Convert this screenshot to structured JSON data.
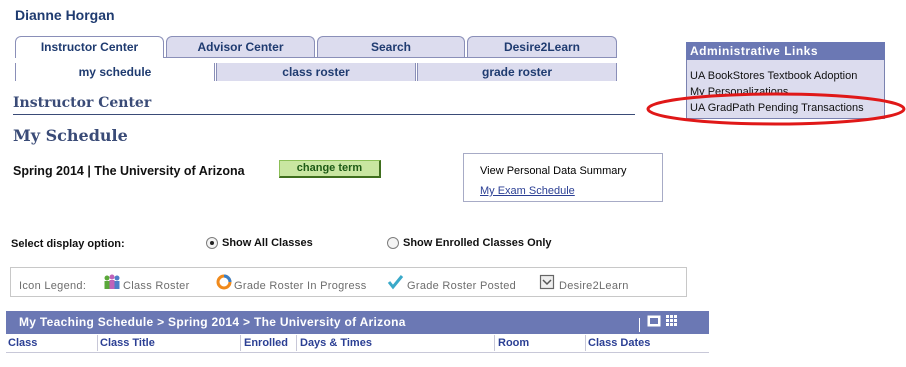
{
  "user": {
    "name": "Dianne Horgan"
  },
  "tabs": [
    {
      "label": "Instructor Center",
      "active": true
    },
    {
      "label": "Advisor Center",
      "active": false
    },
    {
      "label": "Search",
      "active": false
    },
    {
      "label": "Desire2Learn",
      "active": false
    }
  ],
  "subtabs": [
    {
      "label": "my schedule",
      "active": true
    },
    {
      "label": "class roster",
      "active": false
    },
    {
      "label": "grade roster",
      "active": false
    }
  ],
  "section_title": "Instructor Center",
  "page_title": "My Schedule",
  "term": {
    "label": "Spring 2014 | The University of Arizona",
    "change_button": "change term"
  },
  "summary_links": {
    "view_personal": "View Personal Data Summary",
    "exam_schedule": "My Exam Schedule"
  },
  "admin_links": {
    "title": "Administrative Links",
    "items": [
      "UA BookStores Textbook Adoption",
      "My Personalizations",
      "UA GradPath Pending Transactions"
    ]
  },
  "display_option": {
    "label": "Select display option:",
    "options": [
      "Show All Classes",
      "Show Enrolled Classes Only"
    ],
    "selected": "Show All Classes"
  },
  "icon_legend": {
    "label": "Icon Legend:",
    "items": [
      {
        "label": "Class Roster",
        "icon": "class-roster-icon"
      },
      {
        "label": "Grade Roster In Progress",
        "icon": "grade-roster-in-progress-icon"
      },
      {
        "label": "Grade Roster Posted",
        "icon": "grade-roster-posted-icon"
      },
      {
        "label": "Desire2Learn",
        "icon": "desire2learn-icon"
      }
    ]
  },
  "schedule_grid": {
    "title": "My Teaching Schedule > Spring 2014 > The University of Arizona",
    "columns": [
      "Class",
      "Class Title",
      "Enrolled",
      "Days & Times",
      "Room",
      "Class Dates"
    ]
  },
  "colors": {
    "header_blue": "#6b78b4",
    "tab_fill": "#dcdcee",
    "title_text": "#3a4b77",
    "button_green": "#c9e6a1",
    "annotation_red": "#e01818"
  }
}
